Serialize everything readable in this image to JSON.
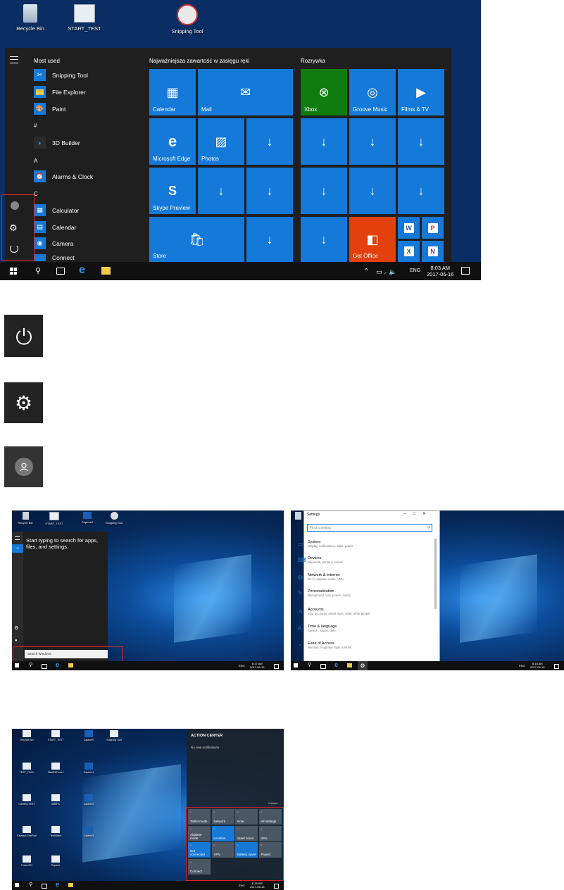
{
  "screenshot_top": {
    "desktop_icons": [
      "Recycle Bin",
      "START_TEST",
      "Snipping Tool"
    ],
    "start_menu": {
      "most_used_header": "Most used",
      "apps": [
        {
          "label": "Snipping Tool"
        },
        {
          "label": "File Explorer"
        },
        {
          "label": "Paint"
        }
      ],
      "letter_hash": "#",
      "app_3d": "3D Builder",
      "letter_a": "A",
      "app_alarms": "Alarms & Clock",
      "letter_c": "C",
      "app_calculator": "Calculator",
      "app_calendar": "Calendar",
      "app_camera": "Camera",
      "app_connect": "Connect",
      "group1_title": "Najważniejsza zawartość w zasięgu ręki",
      "group2_title": "Rozrywka",
      "tiles": {
        "calendar": "Calendar",
        "mail": "Mail",
        "xbox": "Xbox",
        "groove": "Groove Music",
        "films": "Films & TV",
        "edge": "Microsoft Edge",
        "photos": "Photos",
        "skype": "Skype Preview",
        "store": "Store",
        "get_office": "Get Office"
      }
    },
    "taskbar": {
      "lang": "ENG",
      "time": "8:03 AM",
      "date": "2017-06-16"
    }
  },
  "search_screenshot": {
    "desktop_icons": [
      "Recycle Bin",
      "START_TEST",
      "Capture0",
      "Snipping Tool"
    ],
    "prompt": "Start typing to search for apps, files, and settings.",
    "search_box": "Search Windows",
    "lang": "ENG",
    "time": "8:17 AM",
    "date": "2017-06-16"
  },
  "settings_screenshot": {
    "window_title": "Settings",
    "search_placeholder": "Find a setting",
    "items": [
      {
        "title": "System",
        "sub": "Display, notifications, apps, power"
      },
      {
        "title": "Devices",
        "sub": "Bluetooth, printers, mouse"
      },
      {
        "title": "Network & Internet",
        "sub": "Wi-Fi, airplane mode, VPN"
      },
      {
        "title": "Personalization",
        "sub": "Background, lock screen, colors"
      },
      {
        "title": "Accounts",
        "sub": "Your accounts, email, sync, work, other people"
      },
      {
        "title": "Time & language",
        "sub": "Speech, region, date"
      },
      {
        "title": "Ease of Access",
        "sub": "Narrator, magnifier, high contrast"
      }
    ],
    "lang": "ENG",
    "time": "8:18 AM",
    "date": "2017-06-16"
  },
  "action_center_screenshot": {
    "desktop_icons": [
      "Recycle Bin",
      "START_TEST",
      "Capture0",
      "Snipping Tool",
      "TEST_TOOL",
      "StartEAT.exe1",
      "Capture1",
      "Camera-TEST",
      "StartPC",
      "Capture2",
      "Cleanup-TestTool",
      "TestVideo",
      "Capture3",
      "PowerON",
      "Capture"
    ],
    "title": "ACTION CENTER",
    "no_notifications": "No new notifications",
    "collapse": "Collapse",
    "quick_actions": [
      {
        "label": "Tablet mode",
        "on": false
      },
      {
        "label": "Network",
        "on": false
      },
      {
        "label": "Note",
        "on": false
      },
      {
        "label": "All settings",
        "on": false
      },
      {
        "label": "Airplane mode",
        "on": false
      },
      {
        "label": "Location",
        "on": true
      },
      {
        "label": "Quiet hours",
        "on": false
      },
      {
        "label": "40%",
        "on": false
      },
      {
        "label": "Not connected",
        "on": true
      },
      {
        "label": "VPN",
        "on": false
      },
      {
        "label": "Battery saver",
        "on": true
      },
      {
        "label": "Project",
        "on": false
      },
      {
        "label": "Connect",
        "on": false
      }
    ],
    "lang": "ENG",
    "time": "8:18 AM",
    "date": "2017-06-16"
  },
  "icons": [
    "power-icon",
    "settings-gear-icon",
    "user-account-icon"
  ]
}
